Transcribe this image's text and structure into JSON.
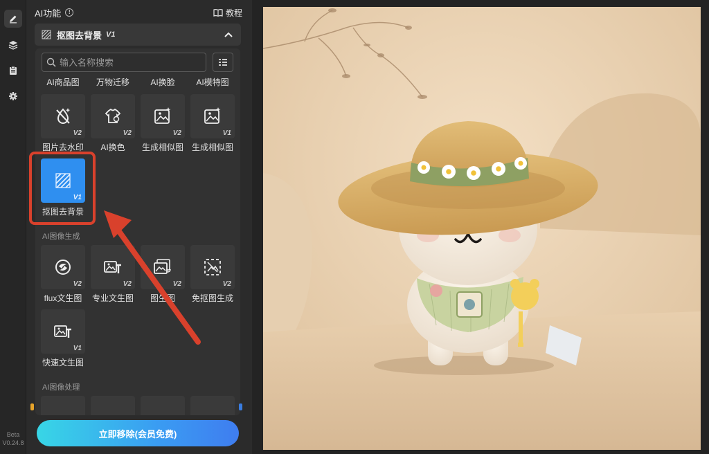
{
  "rail": {
    "icons": [
      "pen-icon",
      "layers-icon",
      "clipboard-icon",
      "gear-icon"
    ],
    "version_line1": "Beta",
    "version_line2": "V0.24.8"
  },
  "panel": {
    "title": "AI功能",
    "tutorial_label": "教程",
    "section": {
      "label": "抠图去背景",
      "version": "V1"
    },
    "search_placeholder": "输入名称搜索",
    "top_row_labels": [
      "AI商品图",
      "万物迁移",
      "AI换脸",
      "AI模特图"
    ],
    "row1": [
      {
        "label": "图片去水印",
        "version": "V2",
        "icon": "watermark-remove-icon"
      },
      {
        "label": "AI换色",
        "version": "V2",
        "icon": "recolor-shirt-icon"
      },
      {
        "label": "生成相似图",
        "version": "V2",
        "icon": "similar-image-icon"
      },
      {
        "label": "生成相似图",
        "version": "V1",
        "icon": "similar-image-icon"
      }
    ],
    "selected_tile": {
      "label": "抠图去背景",
      "version": "V1",
      "icon": "cutout-icon"
    },
    "group_generate": "AI图像生成",
    "row_generate": [
      {
        "label": "flux文生图",
        "version": "V2",
        "icon": "flux-icon"
      },
      {
        "label": "专业文生图",
        "version": "V2",
        "icon": "text-to-image-icon"
      },
      {
        "label": "图生图",
        "version": "V2",
        "icon": "image-to-image-icon"
      },
      {
        "label": "免抠图生成",
        "version": "V2",
        "icon": "no-cutout-icon"
      }
    ],
    "row_generate2": [
      {
        "label": "快速文生图",
        "version": "V1",
        "icon": "text-to-image-icon"
      }
    ],
    "group_process": "AI图像处理",
    "cta_label": "立即移除(会员免费)"
  },
  "colors": {
    "accent": "#2f8ff0",
    "highlight": "#d9412c",
    "cta_start": "#38d6e6",
    "cta_end": "#3f7df0"
  }
}
